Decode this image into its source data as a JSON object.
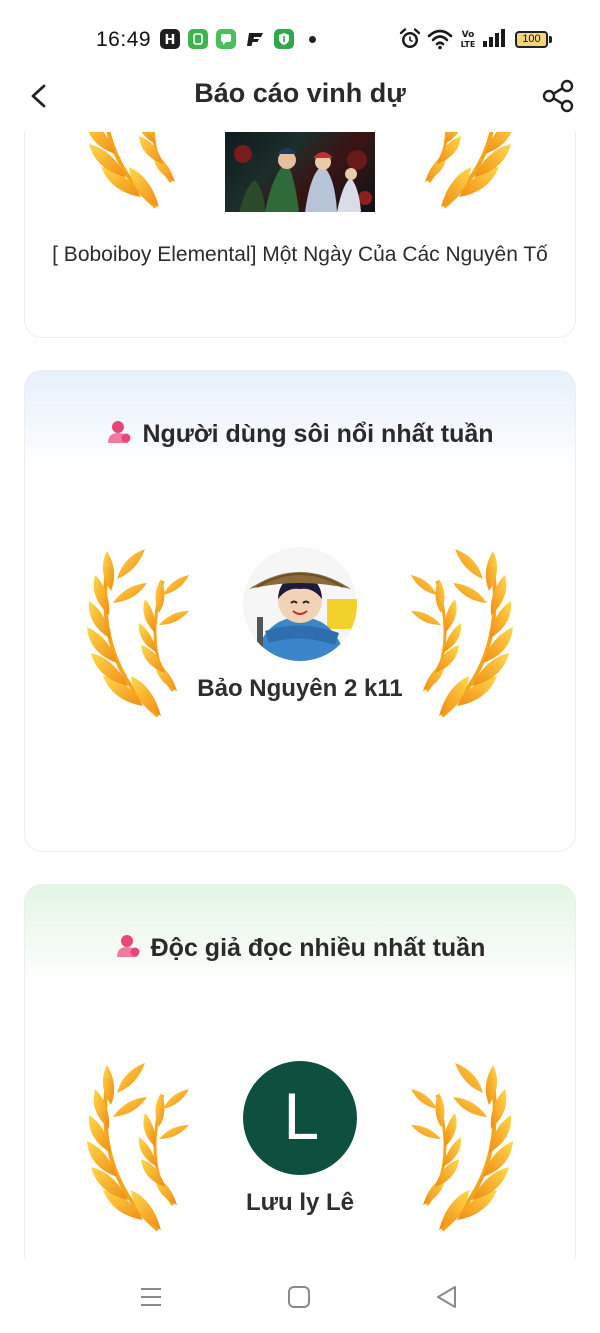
{
  "status_bar": {
    "time": "16:49",
    "battery": "100",
    "app_icons": [
      "h-app-icon",
      "green-app-icon",
      "message-app-icon",
      "f-app-icon",
      "shield-app-icon"
    ],
    "right_icons": [
      "alarm-icon",
      "wifi-icon",
      "volte-icon",
      "signal-icon",
      "battery-icon"
    ]
  },
  "header": {
    "title": "Báo cáo vinh dự",
    "back_icon": "chevron-left-icon",
    "share_icon": "share-icon"
  },
  "story_card": {
    "title": "[ Boboiboy Elemental] Một Ngày Của Các Nguyên Tố"
  },
  "active_user_card": {
    "heading": "Người dùng sôi nổi nhất tuần",
    "winner_name": "Bảo Nguyên 2 k11",
    "accent": "#e6f0fc"
  },
  "top_reader_card": {
    "heading": "Độc giả đọc nhiều nhất tuần",
    "avatar_letter": "L",
    "winner_name": "Lưu ly Lê",
    "accent": "#e3f5e3",
    "avatar_color": "#0e5040"
  },
  "nav_bar": {
    "icons": [
      "menu-icon",
      "home-icon",
      "back-triangle-icon"
    ]
  },
  "colors": {
    "laurel_gold": "#f6b91c",
    "laurel_orange": "#ef8a16",
    "person_icon": "#e8457a"
  }
}
